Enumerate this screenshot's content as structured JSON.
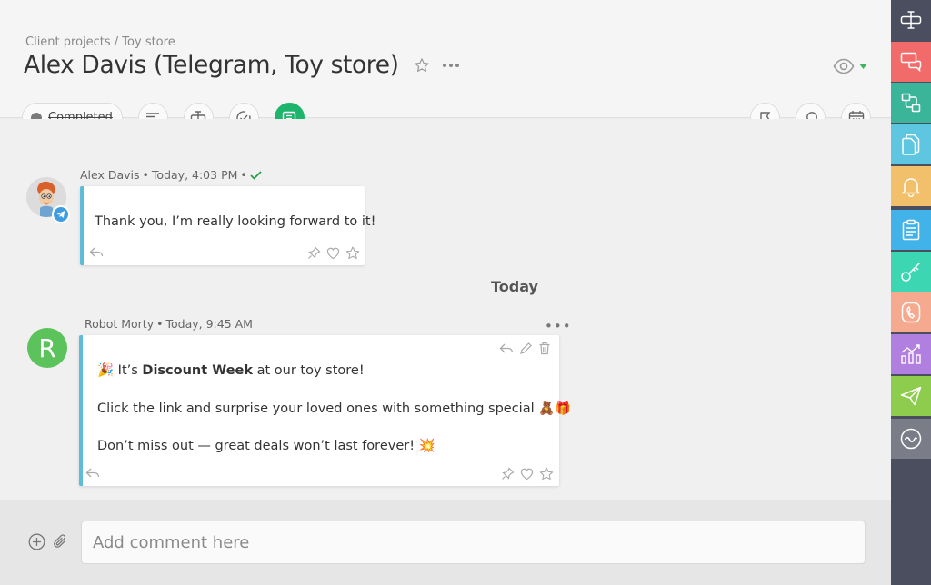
{
  "header": {
    "breadcrumb": "Client projects / Toy store",
    "title": "Alex Davis (Telegram, Toy store)"
  },
  "toolbar": {
    "status_label": "Completed"
  },
  "messages": [
    {
      "author": "Alex Davis",
      "time": "Today, 4:03 PM",
      "text": "Thank you, I’m really looking forward to it!"
    },
    {
      "author": "Robot Morty",
      "avatar_letter": "R",
      "time": "Today, 9:45 AM",
      "line1_emoji": "🎉",
      "line1_prefix": " It’s ",
      "line1_bold": "Discount Week",
      "line1_suffix": " at our toy store!",
      "line2": "Click the link and surprise your loved ones with something special 🧸🎁",
      "line3": "Don’t miss out — great deals won’t last forever! 💥"
    }
  ],
  "day_separator": "Today",
  "more_dots": "•••",
  "composer": {
    "placeholder": "Add comment here"
  },
  "colors": {
    "accent_green": "#1db56b",
    "bubble_border": "#5dbcd9",
    "sidebar_bg": "#4a4e5e",
    "sidebar": [
      "#4a4e5e",
      "#f26b6b",
      "#3bb59a",
      "#5ec6e0",
      "#f2c06a",
      "#42b3e8",
      "#3dd6b3",
      "#f5a98f",
      "#b07fe0",
      "#8dcc4c",
      "#7a7d88"
    ]
  },
  "sidebar_icons": [
    "text-cursor-icon",
    "chat-bubbles-icon",
    "flow-icon",
    "documents-icon",
    "bell-icon",
    "clipboard-icon",
    "key-icon",
    "phone-icon",
    "analytics-icon",
    "paper-plane-icon",
    "wave-icon"
  ]
}
